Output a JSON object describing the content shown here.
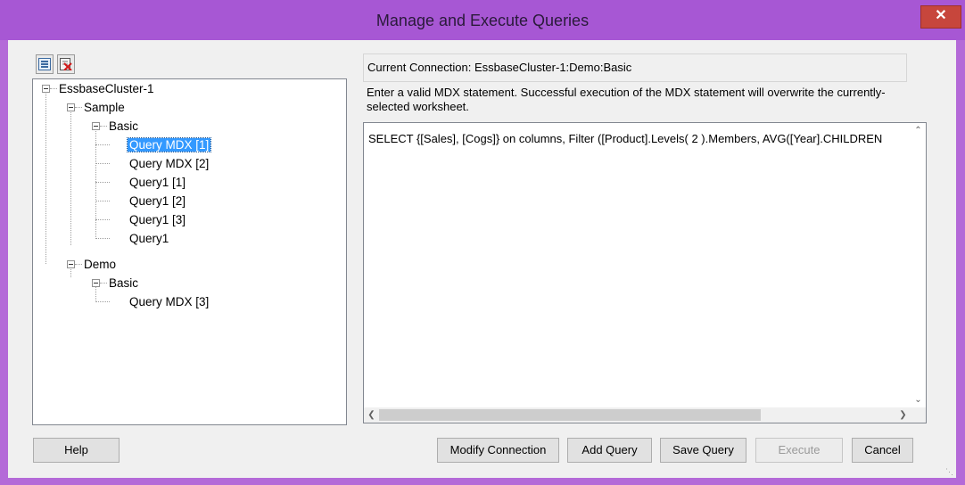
{
  "window": {
    "title": "Manage and Execute Queries",
    "close_label": "✕"
  },
  "toolbar": {
    "expand_icon": "tree-view-icon",
    "delete_icon": "delete-query-icon"
  },
  "tree": {
    "cluster": "EssbaseCluster-1",
    "apps": [
      {
        "name": "Sample",
        "db": "Basic",
        "queries": [
          "Query MDX [1]",
          "Query MDX [2]",
          "Query1 [1]",
          "Query1 [2]",
          "Query1 [3]",
          "Query1"
        ]
      },
      {
        "name": "Demo",
        "db": "Basic",
        "queries": [
          "Query MDX [3]"
        ]
      }
    ],
    "selected": "Query MDX [1]"
  },
  "connection": {
    "label": "Current Connection: EssbaseCluster-1:Demo:Basic"
  },
  "hint": "Enter a valid MDX statement. Successful execution of the MDX statement will overwrite the currently-selected worksheet.",
  "query": {
    "text": "SELECT {[Sales], [Cogs]} on columns, Filter ([Product].Levels( 2 ).Members, AVG([Year].CHILDREN"
  },
  "buttons": {
    "help": "Help",
    "modify": "Modify Connection",
    "add": "Add Query",
    "save": "Save Query",
    "execute": "Execute",
    "cancel": "Cancel"
  },
  "colors": {
    "titlebar": "#a757d4",
    "selection": "#3399ff",
    "close": "#c7463c"
  }
}
